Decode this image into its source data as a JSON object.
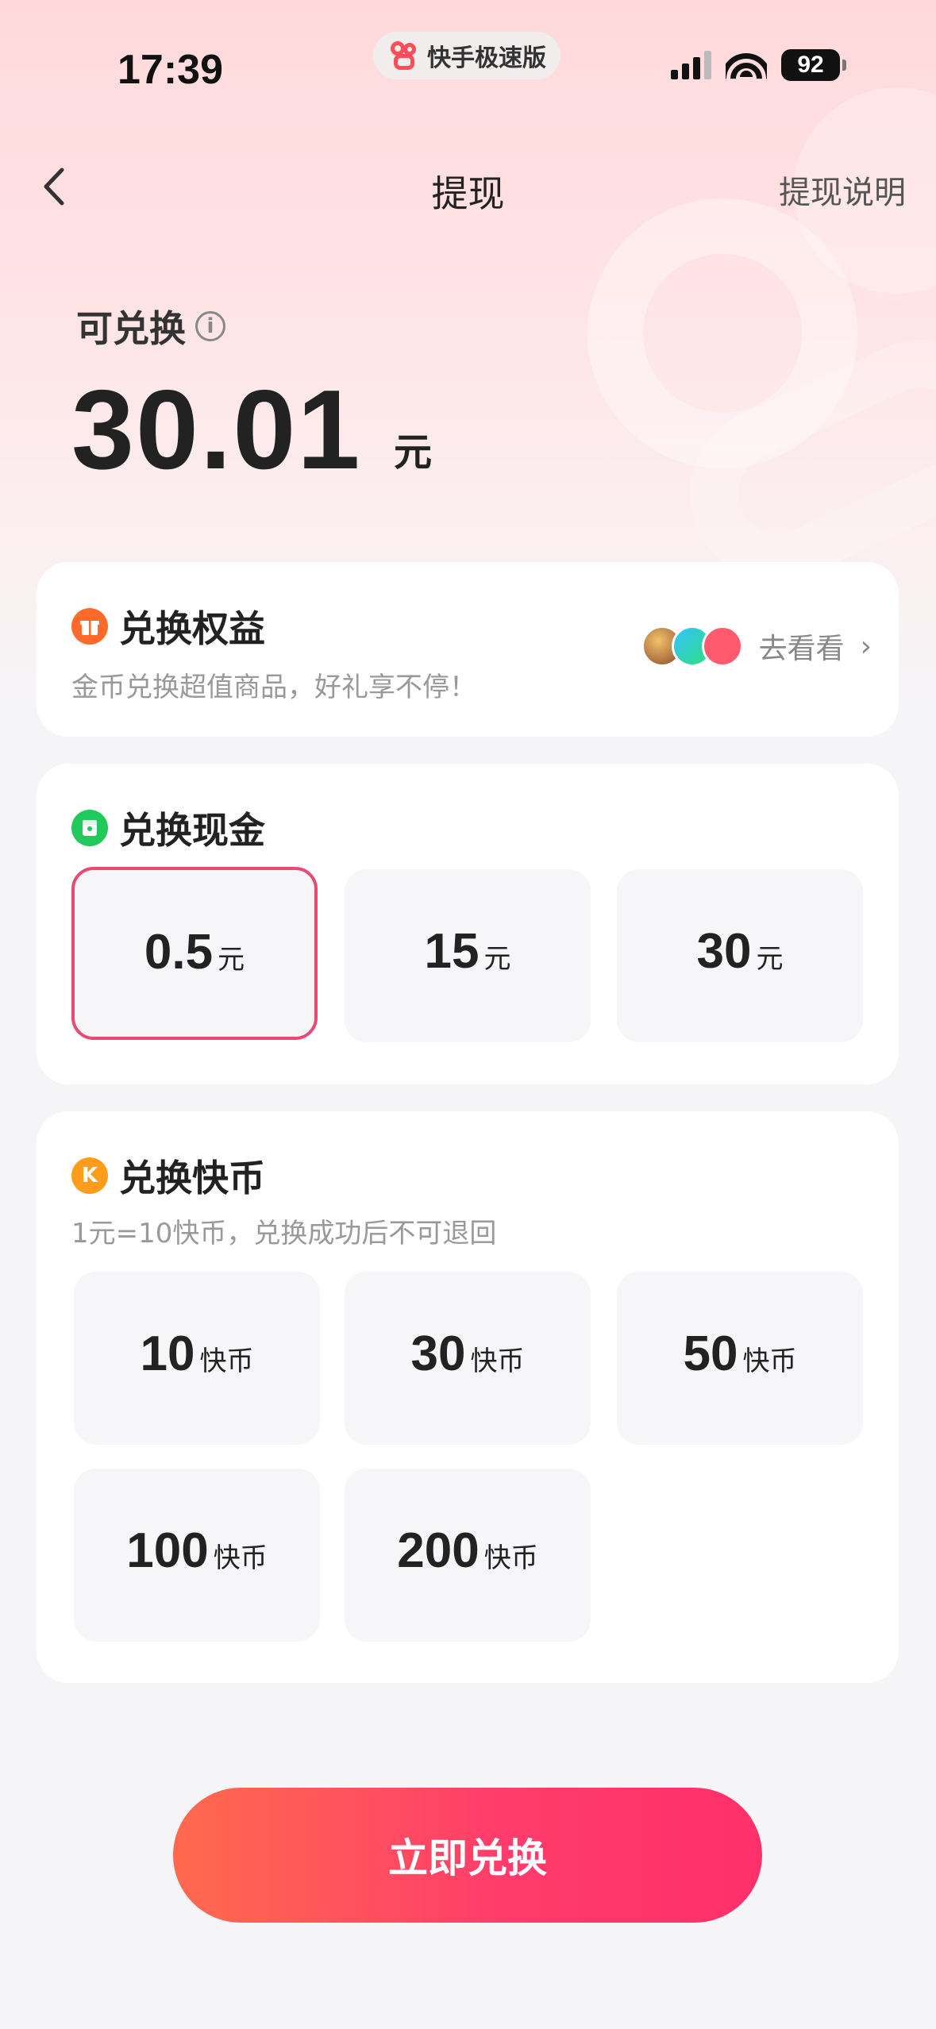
{
  "status_bar": {
    "time": "17:39",
    "app_name": "快手极速版",
    "battery": "92"
  },
  "nav": {
    "title": "提现",
    "right_link": "提现说明"
  },
  "balance": {
    "label": "可兑换",
    "amount": "30.01",
    "unit": "元"
  },
  "benefits": {
    "title": "兑换权益",
    "subtitle": "金币兑换超值商品，好礼享不停！",
    "link": "去看看"
  },
  "cash": {
    "title": "兑换现金",
    "options": [
      {
        "value": "0.5",
        "unit": "元",
        "selected": true
      },
      {
        "value": "15",
        "unit": "元",
        "selected": false
      },
      {
        "value": "30",
        "unit": "元",
        "selected": false
      }
    ]
  },
  "coins": {
    "title": "兑换快币",
    "icon_letter": "K",
    "subtitle": "1元=10快币，兑换成功后不可退回",
    "options": [
      {
        "value": "10",
        "unit": "快币"
      },
      {
        "value": "30",
        "unit": "快币"
      },
      {
        "value": "50",
        "unit": "快币"
      },
      {
        "value": "100",
        "unit": "快币"
      },
      {
        "value": "200",
        "unit": "快币"
      }
    ]
  },
  "cta": {
    "label": "立即兑换"
  },
  "colors": {
    "accent": "#ff3d6b",
    "selected_border": "#e94a74",
    "benefit_icon": "#ff6a2b",
    "cash_icon": "#20c95a",
    "coin_icon": "#ff9c1a"
  }
}
